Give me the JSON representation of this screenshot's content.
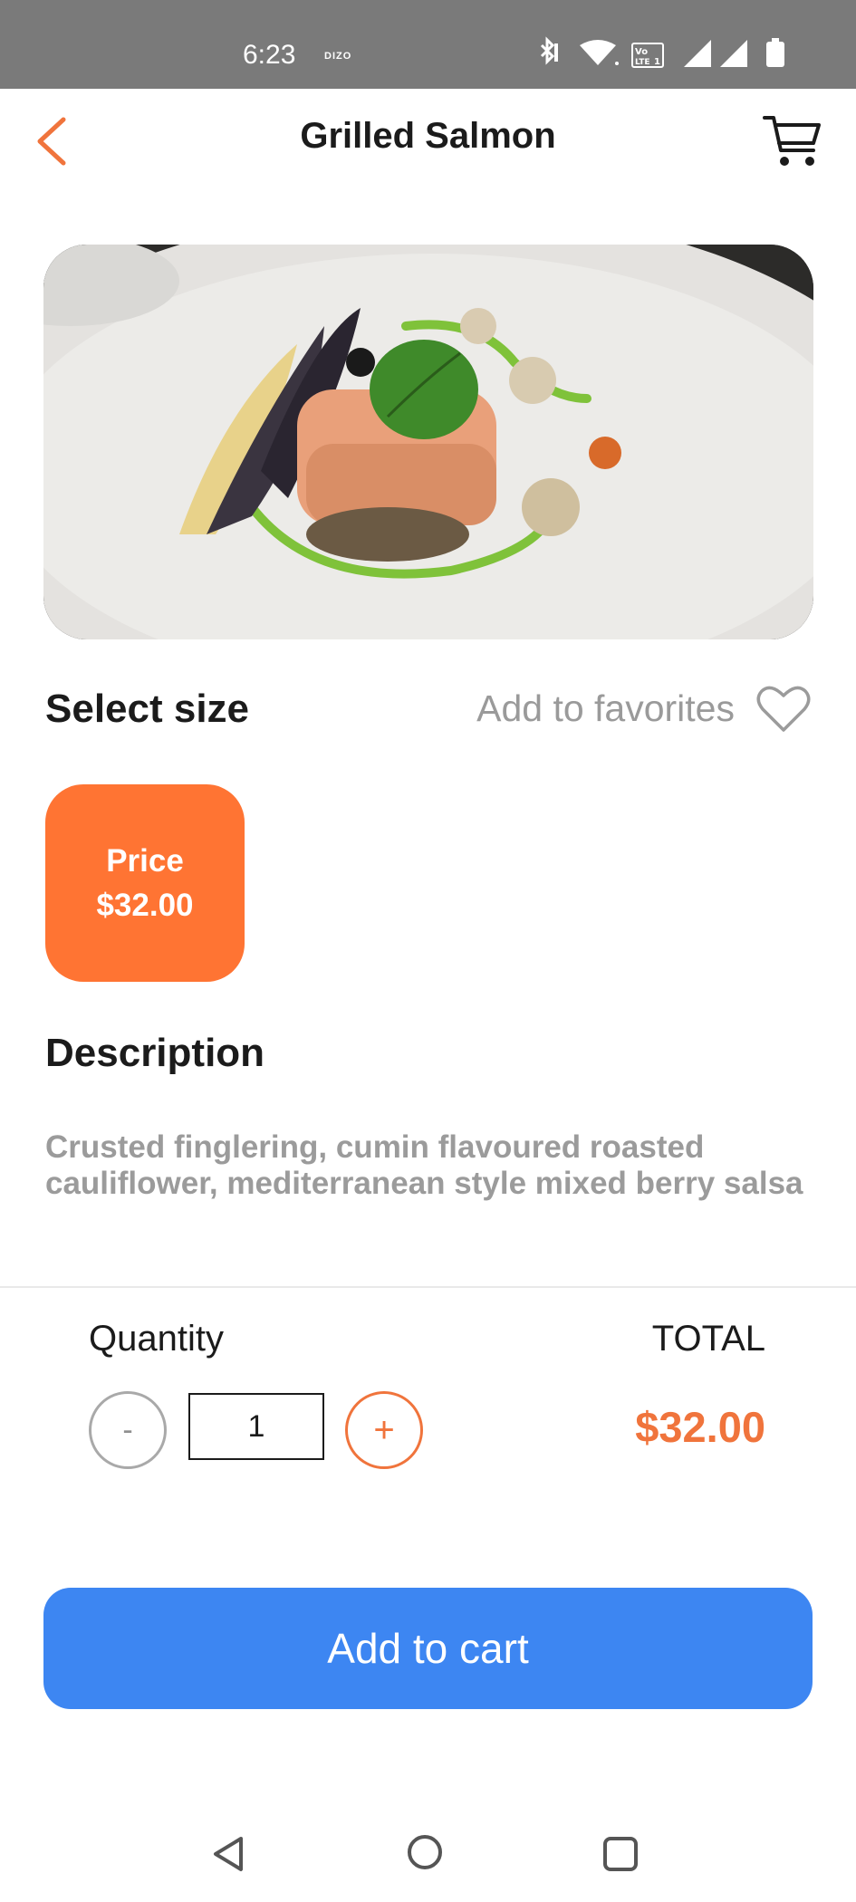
{
  "status_bar": {
    "time": "6:23",
    "carrier": "DIZO",
    "icons": [
      "bluetooth-icon",
      "wifi-icon",
      "volte-icon",
      "signal-icon",
      "signal-icon",
      "battery-icon"
    ]
  },
  "header": {
    "title": "Grilled Salmon",
    "back_icon": "chevron-left-icon",
    "cart_icon": "cart-icon"
  },
  "product": {
    "image_alt": "Grilled Salmon dish"
  },
  "size": {
    "heading": "Select size",
    "favorites_label": "Add to favorites",
    "favorites_icon": "heart-outline-icon",
    "option_label": "Price",
    "option_price": "$32.00"
  },
  "description": {
    "heading": "Description",
    "text": "Crusted finglering, cumin flavoured roasted cauliflower, mediterranean style mixed berry salsa"
  },
  "quantity": {
    "label": "Quantity",
    "minus": "-",
    "value": "1",
    "plus": "+"
  },
  "total": {
    "label": "TOTAL",
    "value": "$32.00"
  },
  "cta": {
    "label": "Add to cart"
  },
  "nav": {
    "icons": [
      "nav-back-icon",
      "nav-home-icon",
      "nav-recent-icon"
    ]
  },
  "colors": {
    "accent": "#ff7433",
    "primary": "#3d86f2",
    "status_bar": "#7a7a7a",
    "muted_text": "#9b9b9b"
  }
}
